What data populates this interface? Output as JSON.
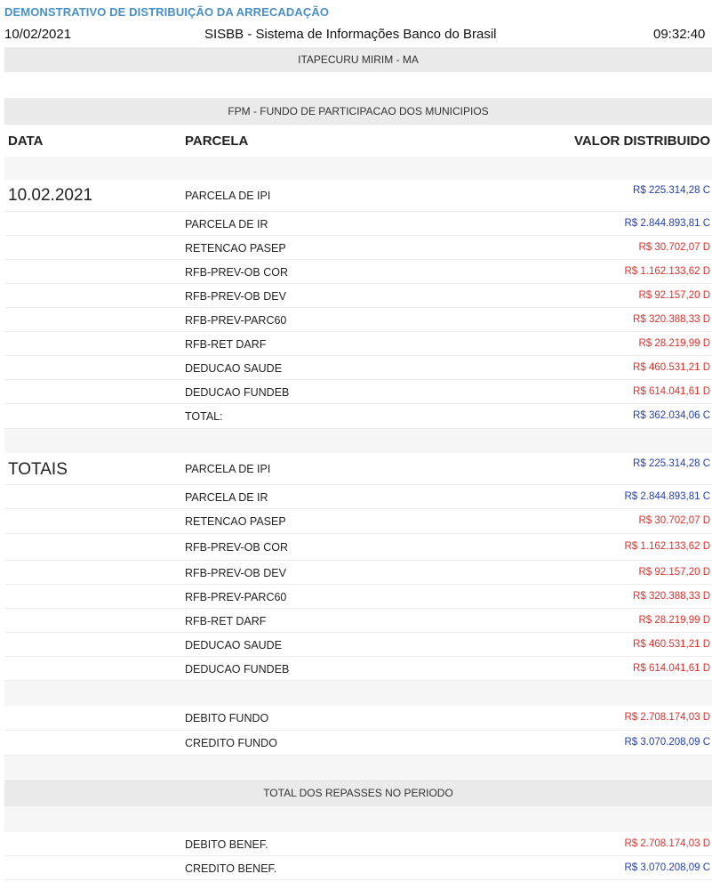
{
  "header": {
    "title": "DEMONSTRATIVO DE DISTRIBUIÇÃO DA ARRECADAÇÃO",
    "date": "10/02/2021",
    "system": "SISBB - Sistema de Informações Banco do Brasil",
    "time": "09:32:40"
  },
  "municipality": "ITAPECURU MIRIM - MA",
  "fund_title": "FPM - FUNDO DE PARTICIPACAO DOS MUNICIPIOS",
  "columns": {
    "date": "DATA",
    "parcel": "PARCELA",
    "value": "VALOR DISTRIBUIDO"
  },
  "section1": {
    "label": "10.02.2021",
    "rows": [
      {
        "parcel": "PARCELA DE IPI",
        "value": "R$ 225.314,28 C"
      },
      {
        "parcel": "PARCELA DE IR",
        "value": "R$ 2.844.893,81 C"
      },
      {
        "parcel": "RETENCAO PASEP",
        "value": "R$ 30.702,07 D"
      },
      {
        "parcel": "RFB-PREV-OB COR",
        "value": "R$ 1.162.133,62 D"
      },
      {
        "parcel": "RFB-PREV-OB DEV",
        "value": "R$ 92.157,20 D"
      },
      {
        "parcel": "RFB-PREV-PARC60",
        "value": "R$ 320.388,33 D"
      },
      {
        "parcel": "RFB-RET DARF",
        "value": "R$ 28.219,99 D"
      },
      {
        "parcel": "DEDUCAO SAUDE",
        "value": "R$ 460.531,21 D"
      },
      {
        "parcel": "DEDUCAO FUNDEB",
        "value": "R$ 614.041,61 D"
      },
      {
        "parcel": "TOTAL:",
        "value": "R$ 362.034,06 C"
      }
    ]
  },
  "section2": {
    "label": "TOTAIS",
    "rows": [
      {
        "parcel": "PARCELA DE IPI",
        "value": "R$ 225.314,28 C"
      },
      {
        "parcel": "PARCELA DE IR",
        "value": "R$ 2.844.893,81 C"
      },
      {
        "parcel": "RETENCAO PASEP",
        "value": "R$ 30.702,07 D"
      },
      {
        "parcel": "RFB-PREV-OB COR",
        "value": "R$ 1.162.133,62 D"
      },
      {
        "parcel": "RFB-PREV-OB DEV",
        "value": "R$ 92.157,20 D"
      },
      {
        "parcel": "RFB-PREV-PARC60",
        "value": "R$ 320.388,33 D"
      },
      {
        "parcel": "RFB-RET DARF",
        "value": "R$ 28.219,99 D"
      },
      {
        "parcel": "DEDUCAO SAUDE",
        "value": "R$ 460.531,21 D"
      },
      {
        "parcel": "DEDUCAO FUNDEB",
        "value": "R$ 614.041,61 D"
      }
    ]
  },
  "fund_totals": [
    {
      "parcel": "DEBITO FUNDO",
      "value": "R$ 2.708.174,03 D"
    },
    {
      "parcel": "CREDITO FUNDO",
      "value": "R$ 3.070.208,09 C"
    }
  ],
  "period_title": "TOTAL DOS REPASSES NO PERIODO",
  "benef_totals": [
    {
      "parcel": "DEBITO BENEF.",
      "value": "R$ 2.708.174,03 D"
    },
    {
      "parcel": "CREDITO BENEF.",
      "value": "R$ 3.070.208,09 C"
    }
  ],
  "colors": {
    "credit": "#2340b8",
    "debit": "#e0302b",
    "title": "#4a8fc7",
    "band": "#eaeaea"
  }
}
